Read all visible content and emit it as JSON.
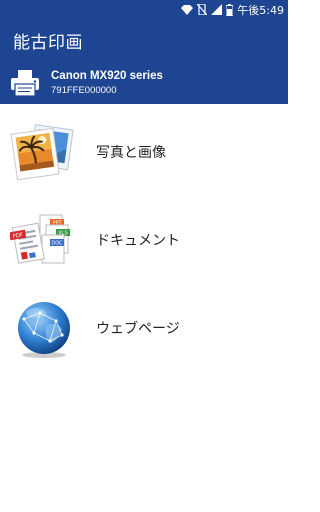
{
  "status_bar": {
    "time": "午後5:49",
    "icons": [
      "network-icon",
      "vibrate-icon",
      "signal-icon",
      "battery-icon"
    ]
  },
  "app_bar": {
    "title": "能古印画"
  },
  "printer": {
    "name": "Canon MX920 series",
    "serial": "791FFE000000",
    "icon": "printer-icon"
  },
  "menu": {
    "items": [
      {
        "label": "写真と画像",
        "icon": "photo-icon"
      },
      {
        "label": "ドキュメント",
        "icon": "documents-icon"
      },
      {
        "label": "ウェブページ",
        "icon": "globe-icon"
      }
    ]
  },
  "colors": {
    "primary": "#1d4592",
    "text": "#222222"
  }
}
